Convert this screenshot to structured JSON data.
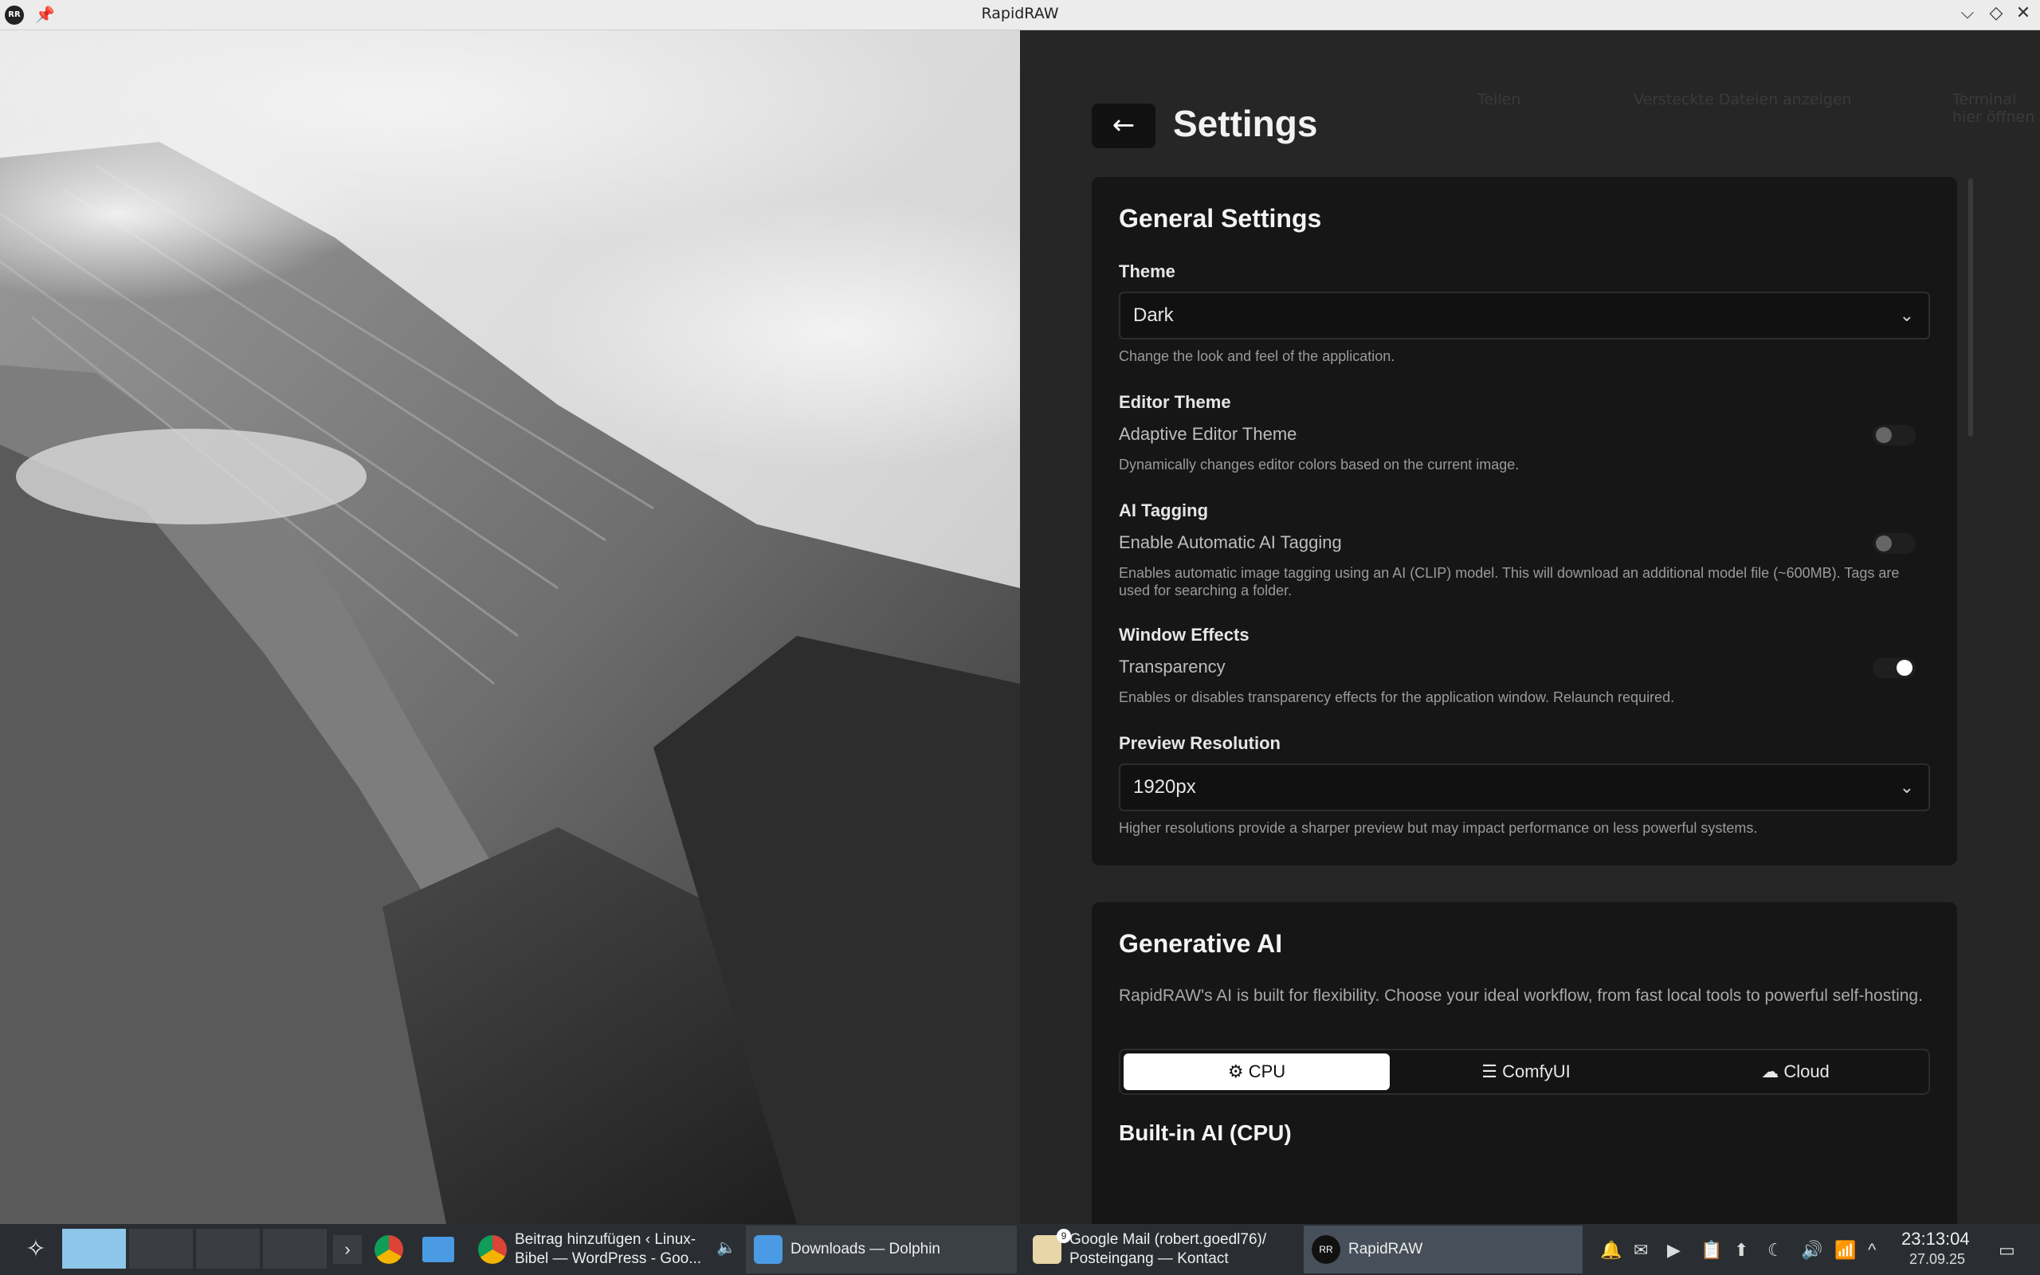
{
  "window": {
    "title": "RapidRAW",
    "app_icon_text": "RR"
  },
  "ghost_toolbar": {
    "share": "Teilen",
    "hidden_files": "Versteckte Dateien anzeigen",
    "terminal": "Terminal hier öffnen"
  },
  "settings": {
    "title": "Settings",
    "general": {
      "title": "General Settings",
      "theme": {
        "label": "Theme",
        "value": "Dark",
        "description": "Change the look and feel of the application."
      },
      "editor_theme": {
        "label": "Editor Theme",
        "option": "Adaptive Editor Theme",
        "enabled": false,
        "description": "Dynamically changes editor colors based on the current image."
      },
      "ai_tagging": {
        "label": "AI Tagging",
        "option": "Enable Automatic AI Tagging",
        "enabled": false,
        "description": "Enables automatic image tagging using an AI (CLIP) model. This will download an additional model file (~600MB). Tags are used for searching a folder."
      },
      "window_effects": {
        "label": "Window Effects",
        "option": "Transparency",
        "enabled": true,
        "description": "Enables or disables transparency effects for the application window. Relaunch required."
      },
      "preview_resolution": {
        "label": "Preview Resolution",
        "value": "1920px",
        "description": "Higher resolutions provide a sharper preview but may impact performance on less powerful systems."
      }
    },
    "generative_ai": {
      "title": "Generative AI",
      "description": "RapidRAW's AI is built for flexibility. Choose your ideal workflow, from fast local tools to powerful self-hosting.",
      "modes": [
        "CPU",
        "ComfyUI",
        "Cloud"
      ],
      "selected_mode": "CPU",
      "builtin_heading": "Built-in AI (CPU)"
    }
  },
  "taskbar": {
    "tasks": [
      {
        "title": "Beitrag hinzufügen ‹ Linux-",
        "subtitle": "Bibel — WordPress - Goo..."
      },
      {
        "title": "Downloads — Dolphin",
        "subtitle": ""
      },
      {
        "title": "Google Mail (robert.goedl76)/",
        "subtitle": "Posteingang — Kontact",
        "badge": "9"
      },
      {
        "title": "RapidRAW",
        "subtitle": ""
      }
    ],
    "clock": {
      "time": "23:13:04",
      "date": "27.09.25"
    }
  }
}
